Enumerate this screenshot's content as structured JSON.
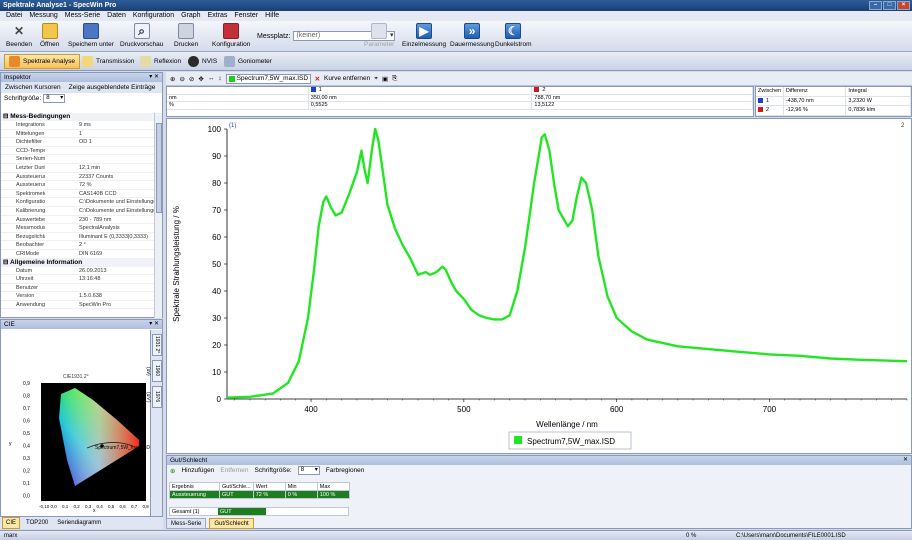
{
  "window": {
    "title": "Spektrale Analyse1 - SpecWin Pro"
  },
  "menu": [
    "Datei",
    "Messung",
    "Mess-Serie",
    "Daten",
    "Konfiguration",
    "Graph",
    "Extras",
    "Fenster",
    "Hilfe"
  ],
  "toolbar": {
    "buttons": [
      "Beenden",
      "Öffnen",
      "Speichern unter",
      "Druckvorschau",
      "Drucken",
      "Konfiguration"
    ],
    "messplatz_label": "Messplatz:",
    "messplatz_value": "(keiner)",
    "parameter": "Parameter",
    "einzelmessung": "Einzelmessung",
    "dauermessung": "Dauermessung",
    "dunkelstrom": "Dunkelstrom"
  },
  "modes": [
    "Spektrale Analyse",
    "Transmission",
    "Reflexion",
    "NVIS",
    "Goniometer"
  ],
  "inspector": {
    "title": "Inspektor",
    "tabs": [
      "Zwischen Kursoren",
      "Zeige ausgeblendete Einträge"
    ],
    "fontsize_label": "Schriftgröße:",
    "fontsize_value": "8",
    "group1": "Mess-Bedingungen",
    "rows1": [
      [
        "Integrationszeit",
        "9 ms"
      ],
      [
        "Mittelungen",
        "1"
      ],
      [
        "Dichtefilter",
        "OD 1"
      ],
      [
        "CCD-Temperatur",
        ""
      ],
      [
        "Serien-Nummer",
        ""
      ],
      [
        "Letzter Dunkelstrom",
        "12,1 min"
      ],
      [
        "Aussteuerung",
        "22337 Counts"
      ],
      [
        "Aussteuerung",
        "72 %"
      ],
      [
        "Spektrometer",
        "CAS140B CCD"
      ],
      [
        "Konfiguration",
        "C:\\Dokumente und Einstellungen"
      ],
      [
        "Kalibrierung",
        "C:\\Dokumente und Einstellungen"
      ],
      [
        "Auswertebereich",
        "230 - 789 nm"
      ],
      [
        "Messmodus",
        "SpectralAnalysis"
      ],
      [
        "Bezugslichtart",
        "Illuminant E (0,3333|0,3333)"
      ],
      [
        "Beobachter",
        "2 °"
      ],
      [
        "CRIMode",
        "DIN 6169"
      ]
    ],
    "group2": "Allgemeine Information",
    "rows2": [
      [
        "Datum",
        "26.09.2013"
      ],
      [
        "Uhrzeit",
        "13:16:48"
      ],
      [
        "Benutzer",
        ""
      ],
      [
        "Version",
        "1.5.0.638"
      ],
      [
        "Anwendung",
        "SpecWin Pro"
      ]
    ]
  },
  "cie": {
    "title": "CIE",
    "chart_title": "CIE1931 2°",
    "point_label": "Spectrum7,5W_max.ISD",
    "side_tabs": [
      "1931 2°",
      "1960 (uv)",
      "1976 (u'v')"
    ],
    "y_ticks": [
      "0,9",
      "0,8",
      "0,7",
      "0,6",
      "0,5",
      "0,4",
      "0,3",
      "0,2",
      "0,1",
      "0,0"
    ],
    "x_ticks": [
      "-0,10",
      "0,0",
      "0,1",
      "0,2",
      "0,3",
      "0,4",
      "0,5",
      "0,6",
      "0,7",
      "0,8"
    ],
    "x_label": "x",
    "y_label": "y",
    "bottom_tabs": [
      "CIE",
      "TOP200",
      "Seriendiagramm"
    ]
  },
  "chart_toolbar": {
    "spectrum": "Spectrum7,5W_max.ISD",
    "remove": "Kurve entfernen"
  },
  "cursor_table": {
    "header": [
      "",
      "1",
      "2"
    ],
    "rows": [
      [
        "nm",
        "350,00 nm",
        "788,70 nm"
      ],
      [
        "%",
        "0,5525",
        "13,5122"
      ]
    ]
  },
  "diff_table": {
    "header": [
      "Zwischen",
      "Differenz",
      "Integral"
    ],
    "rows": [
      [
        "1",
        "-438,70 nm",
        "3,2320 W"
      ],
      [
        "2",
        "-12,96 %",
        "0,7836 klm"
      ]
    ]
  },
  "colors": {
    "spectrum": "#22e622",
    "cursor1": "#1a3fd1",
    "cursor2": "#d11a1a",
    "ok_green": "#1e7d1e"
  },
  "chart_data": {
    "type": "line",
    "title": "",
    "xlabel": "Wellenlänge / nm",
    "ylabel": "Spektrale Strahlungsleistung / %",
    "xlim": [
      345,
      790
    ],
    "ylim": [
      0,
      100
    ],
    "x_ticks": [
      400,
      500,
      600,
      700
    ],
    "y_ticks": [
      0,
      10,
      20,
      30,
      40,
      50,
      60,
      70,
      80,
      90,
      100
    ],
    "grid": false,
    "legend": "bottom-center",
    "cursor_labels": [
      "(1)",
      "2"
    ],
    "series": [
      {
        "name": "Spectrum7,5W_max.ISD",
        "x": [
          345,
          360,
          375,
          385,
          392,
          398,
          402,
          405,
          408,
          410,
          413,
          416,
          420,
          425,
          430,
          433,
          435,
          437,
          440,
          442,
          444,
          447,
          450,
          455,
          460,
          465,
          470,
          475,
          478,
          482,
          486,
          488,
          492,
          495,
          500,
          505,
          510,
          515,
          520,
          525,
          530,
          535,
          540,
          543,
          546,
          549,
          551,
          553,
          556,
          559,
          562,
          565,
          568,
          571,
          574,
          577,
          580,
          584,
          588,
          594,
          600,
          610,
          620,
          640,
          660,
          680,
          700,
          720,
          740,
          760,
          790
        ],
        "values": [
          0.5,
          0.8,
          2,
          6,
          14,
          30,
          48,
          64,
          73,
          75,
          71,
          68,
          69,
          76,
          84,
          92,
          85,
          80,
          93,
          100,
          96,
          84,
          72,
          63,
          57,
          52,
          46,
          47,
          46,
          47,
          49,
          48,
          43,
          40,
          37,
          33,
          31,
          30,
          29.5,
          29.5,
          31,
          40,
          56,
          68,
          80,
          90,
          97,
          98,
          92,
          80,
          70,
          67,
          64,
          66,
          75,
          82,
          80,
          70,
          53,
          38,
          30,
          25,
          22,
          19.5,
          18.5,
          17.5,
          16.5,
          16,
          15,
          14.5,
          14
        ]
      }
    ]
  },
  "gut": {
    "title": "Gut/Schlecht",
    "toolbar": [
      "Hinzufügen",
      "Entfernen",
      "Schriftgröße:",
      "8",
      "Farbregionen"
    ],
    "header": [
      "Ergebnis",
      "Gut/Schle...",
      "Wert",
      "Min",
      "Max"
    ],
    "row": [
      "Aussteuerung",
      "GUT",
      "72 %",
      "0 %",
      "100 %"
    ],
    "total_label": "Gesamt (1)",
    "total_value": "GUT",
    "bottom_tabs": [
      "Mess-Serie",
      "Gut/Schlecht"
    ]
  },
  "status": {
    "user": "marx",
    "percent": "0 %",
    "path": "C:\\Users\\marx\\Documents\\FILE0001.ISD"
  }
}
